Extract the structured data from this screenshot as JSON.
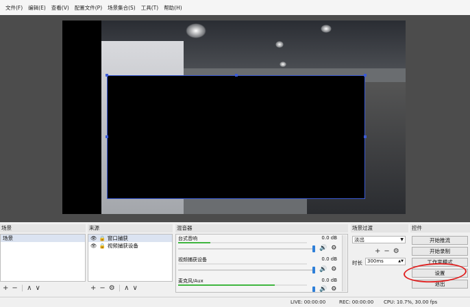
{
  "menu": [
    "文件(F)",
    "编辑(E)",
    "查看(V)",
    "配置文件(P)",
    "场景集合(S)",
    "工具(T)",
    "帮助(H)"
  ],
  "docks": {
    "scenes": {
      "title": "场景",
      "items": [
        "场景"
      ]
    },
    "sources": {
      "title": "来源",
      "items": [
        "窗口捕获",
        "视频捕获设备"
      ]
    },
    "mixer": {
      "title": "混音器",
      "channels": [
        {
          "name": "台式音响",
          "db": "0.0 dB",
          "level": 0.25
        },
        {
          "name": "视频捕获设备",
          "db": "0.0 dB",
          "level": 0.0
        },
        {
          "name": "麦克风/Aux",
          "db": "0.0 dB",
          "level": 0.75
        }
      ]
    },
    "transitions": {
      "title": "场景过渡",
      "type": "淡出",
      "duration_label": "时长",
      "duration": "300ms"
    },
    "controls": {
      "title": "控件",
      "buttons": [
        "开始推流",
        "开始录制",
        "工作室模式",
        "设置",
        "退出"
      ]
    }
  },
  "status": {
    "live": "LIVE: 00:00:00",
    "rec": "REC: 00:00:00",
    "cpu": "CPU: 10.7%, 30.00 fps"
  },
  "colors": {
    "selection": "#3b5bd6",
    "annotation": "#e02020",
    "meter": "#3db53d"
  }
}
